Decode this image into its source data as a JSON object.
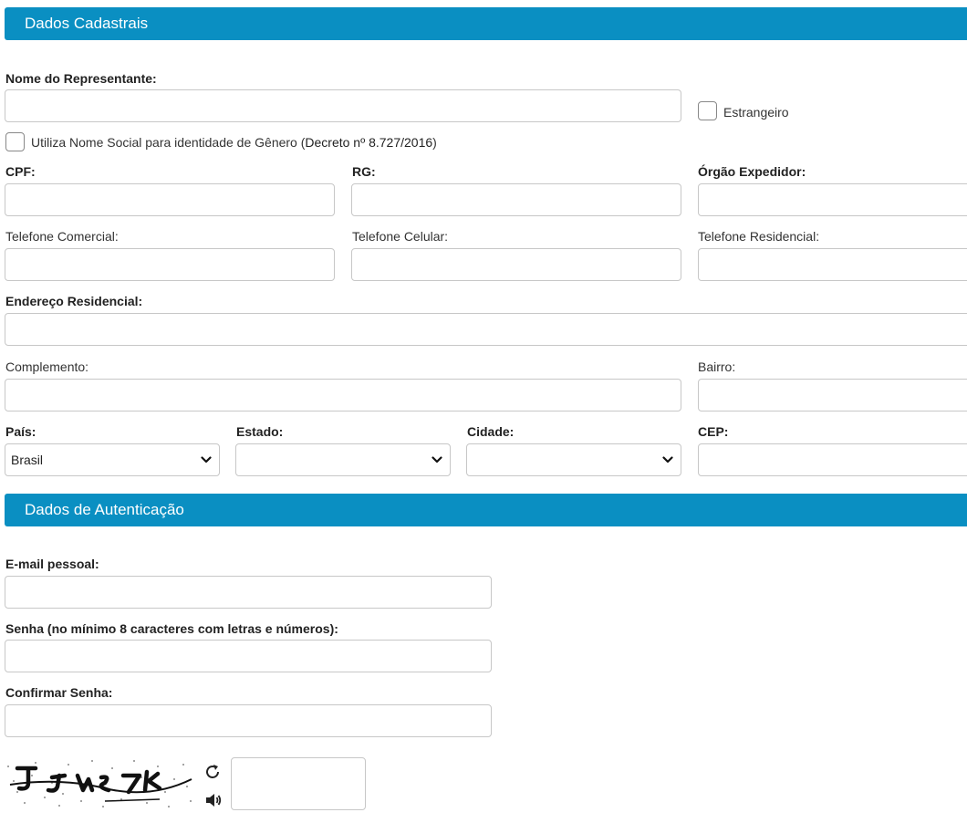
{
  "sections": {
    "cadastrais": "Dados Cadastrais",
    "autenticacao": "Dados de Autenticação"
  },
  "labels": {
    "nome": "Nome do Representante:",
    "estrangeiro": "Estrangeiro",
    "nome_social_prefix": "Utiliza Nome Social para identidade de Gênero (",
    "decreto": "Decreto nº 8.727/2016",
    "nome_social_suffix": ")",
    "cpf": "CPF:",
    "rg": "RG:",
    "orgao": "Órgão Expedidor:",
    "tel_comercial": "Telefone Comercial:",
    "tel_celular": "Telefone Celular:",
    "tel_residencial": "Telefone Residencial:",
    "endereco": "Endereço Residencial:",
    "complemento": "Complemento:",
    "bairro": "Bairro:",
    "pais": "País:",
    "estado": "Estado:",
    "cidade": "Cidade:",
    "cep": "CEP:",
    "email": "E-mail pessoal:",
    "senha": "Senha (no mínimo 8 caracteres com letras e números):",
    "confirmar": "Confirmar Senha:"
  },
  "selects": {
    "pais_value": "Brasil",
    "estado_value": "",
    "cidade_value": ""
  },
  "icons": {
    "captcha_refresh": "refresh-icon",
    "captcha_audio": "speaker-icon",
    "chevron": "chevron-down-icon"
  }
}
